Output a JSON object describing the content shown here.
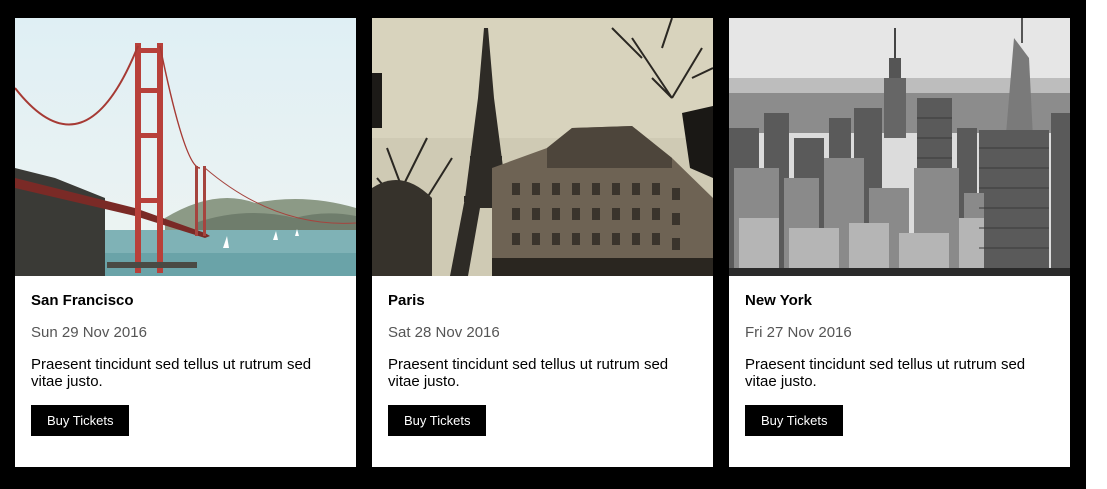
{
  "cards": [
    {
      "city": "San Francisco",
      "date": "Sun 29 Nov 2016",
      "description": "Praesent tincidunt sed tellus ut rutrum sed vitae justo.",
      "button_label": "Buy Tickets",
      "image_alt": "Golden Gate Bridge"
    },
    {
      "city": "Paris",
      "date": "Sat 28 Nov 2016",
      "description": "Praesent tincidunt sed tellus ut rutrum sed vitae justo.",
      "button_label": "Buy Tickets",
      "image_alt": "Eiffel Tower"
    },
    {
      "city": "New York",
      "date": "Fri 27 Nov 2016",
      "description": "Praesent tincidunt sed tellus ut rutrum sed vitae justo.",
      "button_label": "Buy Tickets",
      "image_alt": "New York skyline"
    }
  ],
  "colors": {
    "background": "#000000",
    "card": "#ffffff",
    "button": "#000000",
    "button_text": "#ffffff",
    "date_text": "#555555"
  }
}
